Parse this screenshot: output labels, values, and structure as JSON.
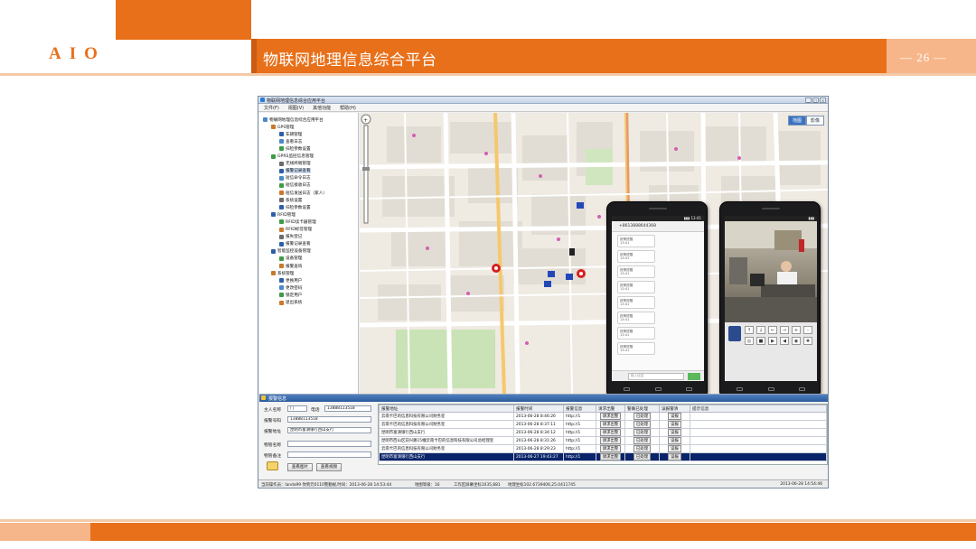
{
  "slide": {
    "logo": "AIO",
    "title": "物联网地理信息综合平台",
    "page_number": "— 26 —",
    "colors": {
      "accent": "#e8701a",
      "accent_light": "#f7b68a",
      "rule": "#f3c9a8"
    }
  },
  "app": {
    "window_title": "物联网地理信息综合应用平台",
    "window_buttons": [
      "_",
      "□",
      "×"
    ],
    "menu": [
      "文件(F)",
      "视图(V)",
      "其他功能",
      "帮助(H)"
    ],
    "tree": [
      {
        "label": "物联网地理信息综合应用平台",
        "level": 0,
        "icon": "globe-icon"
      },
      {
        "label": "GPS管理",
        "level": 1,
        "icon": "gps-icon"
      },
      {
        "label": "车辆管理",
        "level": 2,
        "icon": "car-icon"
      },
      {
        "label": "查看日志",
        "level": 2,
        "icon": "log-icon"
      },
      {
        "label": "扫检参数设置",
        "level": 2,
        "icon": "settings-icon"
      },
      {
        "label": "GPRS监控信息管理",
        "level": 1,
        "icon": "monitor-icon"
      },
      {
        "label": "无线终端管理",
        "level": 2,
        "icon": "terminal-icon"
      },
      {
        "label": "报警记录查看",
        "level": 2,
        "icon": "alarm-icon",
        "selected": true
      },
      {
        "label": "短信命令日志",
        "level": 2,
        "icon": "sms-icon"
      },
      {
        "label": "短信接收日志",
        "level": 2,
        "icon": "sms-icon"
      },
      {
        "label": "短信发送日志（家人）",
        "level": 2,
        "icon": "sms-icon"
      },
      {
        "label": "系统设置",
        "level": 2,
        "icon": "settings-icon"
      },
      {
        "label": "扫检参数设置",
        "level": 2,
        "icon": "settings-icon"
      },
      {
        "label": "RFID管理",
        "level": 1,
        "icon": "rfid-icon"
      },
      {
        "label": "RFID读卡器管理",
        "level": 2,
        "icon": "reader-icon"
      },
      {
        "label": "RFID标签管理",
        "level": 2,
        "icon": "tag-icon"
      },
      {
        "label": "报失登记",
        "level": 2,
        "icon": "report-icon"
      },
      {
        "label": "报警记录查看",
        "level": 2,
        "icon": "alarm-icon"
      },
      {
        "label": "智能监控设备管理",
        "level": 1,
        "icon": "camera-icon"
      },
      {
        "label": "设备管理",
        "level": 2,
        "icon": "device-icon"
      },
      {
        "label": "报警查询",
        "level": 2,
        "icon": "search-icon"
      },
      {
        "label": "系统管理",
        "level": 1,
        "icon": "system-icon"
      },
      {
        "label": "更换用户",
        "level": 2,
        "icon": "user-icon"
      },
      {
        "label": "更改密码",
        "level": 2,
        "icon": "key-icon"
      },
      {
        "label": "锁定用户",
        "level": 2,
        "icon": "lock-icon"
      },
      {
        "label": "退出系统",
        "level": 2,
        "icon": "exit-icon"
      }
    ],
    "map": {
      "type_buttons": [
        "地图",
        "影像"
      ],
      "active_type": "地图"
    },
    "phone1": {
      "number": "+8613888644368",
      "messages": [
        "报警提醒\n13:41",
        "报警提醒\n13:41",
        "报警提醒\n13:41",
        "报警提醒\n13:41",
        "报警提醒\n13:41",
        "报警提醒\n13:41",
        "报警提醒\n13:41",
        "报警提醒\n13:41"
      ],
      "input_placeholder": "输入信息"
    },
    "phone2": {
      "ptz_buttons": [
        "↑",
        "↓",
        "←",
        "→",
        "+",
        "-",
        "◎",
        "■",
        "▶",
        "◀",
        "◉",
        "✚"
      ]
    },
    "info_panel": {
      "title": "报警信息",
      "fields": {
        "owner_label": "主人名称",
        "owner_value": "门",
        "phone_label": "电话",
        "phone_value": "13888113518",
        "alarm_number_label": "报警号码",
        "alarm_number_value": "13888113518",
        "alarm_address_label": "报警地址",
        "alarm_address_value": "昆明市富滇银行西山支行",
        "item_name_label": "物管名称",
        "item_remark_label": "物管备注"
      },
      "buttons": {
        "view_image": "查看图片",
        "view_video": "查看视频"
      },
      "table": {
        "headers": [
          "报警地址",
          "报警时间",
          "报警信息",
          "请求出警",
          "警确已处理",
          "误报警清",
          "提示信息"
        ],
        "rows": [
          [
            "云南卡巴的信息科技有限公司财务室",
            "2013-06-28 8:46:26",
            "http://1",
            "请求出警",
            "已处理",
            "误报",
            ""
          ],
          [
            "云南卡巴的信息科技有限公司财务室",
            "2013-06-28 8:37:11",
            "http://1",
            "请求出警",
            "已处理",
            "误报",
            ""
          ],
          [
            "昆明市富滇银行西山支行",
            "2013-06-28 8:34:12",
            "http://1",
            "请求出警",
            "已处理",
            "误报",
            ""
          ],
          [
            "昆明市西山区前兴路15幢云南卡巴的信息科技有限公司总经理室",
            "2013-06-28 8:31:26",
            "http://1",
            "请求出警",
            "已处理",
            "误报",
            ""
          ],
          [
            "云南卡巴的信息科技有限公司财务室",
            "2013-06-28 8:29:23",
            "http://1",
            "请求出警",
            "已处理",
            "误报",
            ""
          ],
          [
            "昆明市富滇银行西山支行",
            "2013-06-27 19:43:27",
            "http://1",
            "请求出警",
            "已处理",
            "误报",
            ""
          ]
        ],
        "selected_row": 5
      }
    },
    "statusbar": {
      "operator": "当前操作员：landa99  你到元0110警勤规,时间：2013-06-28 14:53:44",
      "map_level": "地图等级：16",
      "workspace": "工作区屏幕坐标1035,881",
      "geo": "地理坐标102.6739406,25.0411745",
      "time": "2013-06-28 14:54:46"
    }
  }
}
